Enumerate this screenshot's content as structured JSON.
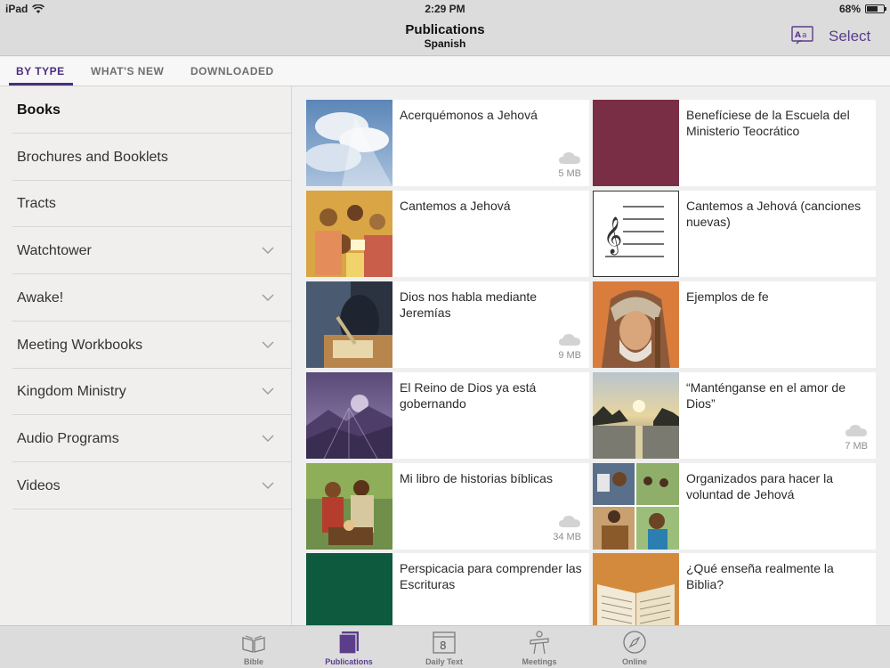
{
  "status": {
    "device": "iPad",
    "time": "2:29 PM",
    "battery": "68%",
    "battery_level": 0.68
  },
  "header": {
    "title": "Publications",
    "subtitle": "Spanish",
    "select_label": "Select",
    "lang_icon": "translate-icon"
  },
  "tabs": [
    {
      "label": "BY TYPE",
      "active": true
    },
    {
      "label": "WHAT'S NEW",
      "active": false
    },
    {
      "label": "DOWNLOADED",
      "active": false
    }
  ],
  "sidebar": {
    "items": [
      {
        "label": "Books",
        "active": true,
        "expandable": false
      },
      {
        "label": "Brochures and Booklets",
        "active": false,
        "expandable": false
      },
      {
        "label": "Tracts",
        "active": false,
        "expandable": false
      },
      {
        "label": "Watchtower",
        "active": false,
        "expandable": true
      },
      {
        "label": "Awake!",
        "active": false,
        "expandable": true
      },
      {
        "label": "Meeting Workbooks",
        "active": false,
        "expandable": true
      },
      {
        "label": "Kingdom Ministry",
        "active": false,
        "expandable": true
      },
      {
        "label": "Audio Programs",
        "active": false,
        "expandable": true
      },
      {
        "label": "Videos",
        "active": false,
        "expandable": true
      }
    ]
  },
  "publications": [
    {
      "title": "Acerquémonos a Jehová",
      "size": "5 MB",
      "downloadable": true,
      "thumb": "sky"
    },
    {
      "title": "Benefíciese de la Escuela del Ministerio Teocrático",
      "size": "",
      "downloadable": false,
      "thumb": "maroon"
    },
    {
      "title": "Cantemos a Jehová",
      "size": "",
      "downloadable": false,
      "thumb": "singers"
    },
    {
      "title": "Cantemos a Jehová (canciones nuevas)",
      "size": "",
      "downloadable": false,
      "thumb": "music"
    },
    {
      "title": "Dios nos habla mediante Jeremías",
      "size": "9 MB",
      "downloadable": true,
      "thumb": "scribe"
    },
    {
      "title": "Ejemplos de fe",
      "size": "",
      "downloadable": false,
      "thumb": "elder"
    },
    {
      "title": "El Reino de Dios ya está gobernando",
      "size": "",
      "downloadable": false,
      "thumb": "mountains"
    },
    {
      "title": "“Manténganse en el amor de Dios”",
      "size": "7 MB",
      "downloadable": true,
      "thumb": "sunset"
    },
    {
      "title": "Mi libro de historias bíblicas",
      "size": "34 MB",
      "downloadable": true,
      "thumb": "family"
    },
    {
      "title": "Organizados para hacer la voluntad de Jehová",
      "size": "",
      "downloadable": false,
      "thumb": "collage"
    },
    {
      "title": "Perspicacia para comprender las Escrituras",
      "size": "",
      "downloadable": false,
      "thumb": "green"
    },
    {
      "title": "¿Qué enseña realmente la Biblia?",
      "size": "",
      "downloadable": false,
      "thumb": "bible"
    }
  ],
  "tabbar": [
    {
      "label": "Bible",
      "icon": "open-book-icon",
      "active": false
    },
    {
      "label": "Publications",
      "icon": "publications-icon",
      "active": true
    },
    {
      "label": "Daily Text",
      "icon": "calendar-icon",
      "active": false,
      "day": "8"
    },
    {
      "label": "Meetings",
      "icon": "lectern-icon",
      "active": false
    },
    {
      "label": "Online",
      "icon": "compass-icon",
      "active": false
    }
  ],
  "colors": {
    "accent": "#4a2f7e",
    "select": "#5b3d8c",
    "maroon": "#7a2e45",
    "green": "#0e5a3e"
  }
}
